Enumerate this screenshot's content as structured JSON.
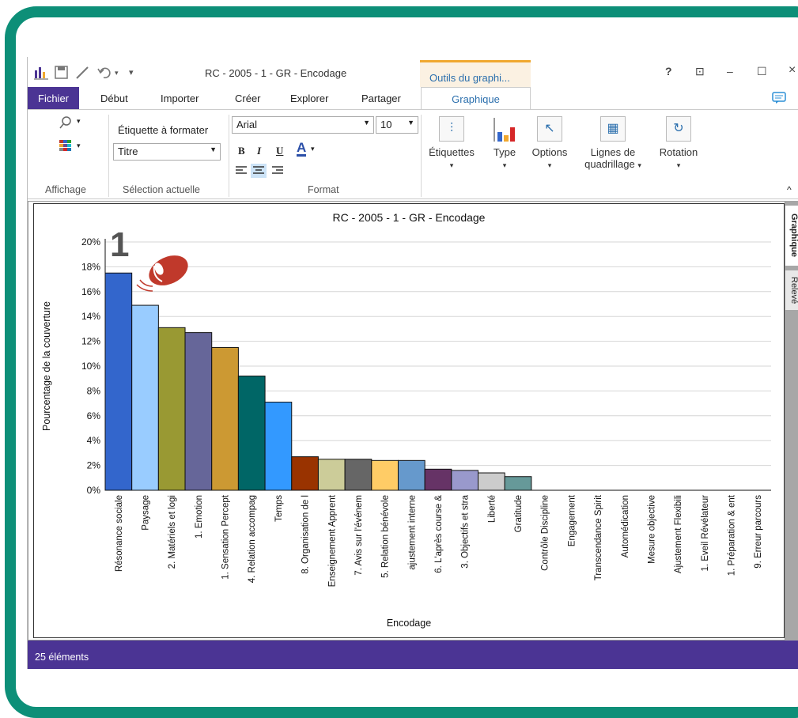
{
  "window": {
    "title": "RC - 2005 - 1 - GR - Encodage",
    "context_tab": "Outils du graphi...",
    "help": "?",
    "restore": "⊡",
    "minimize": "–",
    "maximize": "☐",
    "close": "×"
  },
  "tabs": [
    "Fichier",
    "Début",
    "Importer",
    "Créer",
    "Explorer",
    "Partager",
    "Graphique"
  ],
  "ribbon": {
    "affichage_label": "Affichage",
    "selection_label": "Sélection actuelle",
    "format_label": "Format",
    "etiquette_a_formater": "Étiquette à formater",
    "titre_select": "Titre",
    "font_name": "Arial",
    "font_size": "10",
    "bold": "B",
    "italic": "I",
    "underline": "U",
    "font_color": "A",
    "buttons": {
      "etiquettes": "Étiquettes",
      "type": "Type",
      "options": "Options",
      "lignes_1": "Lignes de",
      "lignes_2": "quadrillage",
      "rotation": "Rotation"
    },
    "collapse": "^"
  },
  "side_tabs": [
    "Graphique",
    "Relevé"
  ],
  "annotation_number": "1",
  "status_text": "25 éléments",
  "colors": {
    "frame": "#0d8f78",
    "purple": "#4b3494",
    "mouse_red": "#c0392b"
  },
  "chart_data": {
    "type": "bar",
    "title": "RC - 2005 - 1 - GR - Encodage",
    "xlabel": "Encodage",
    "ylabel": "Pourcentage de la couverture",
    "ylim": [
      0,
      20
    ],
    "yticks": [
      "0%",
      "2%",
      "4%",
      "6%",
      "8%",
      "10%",
      "12%",
      "14%",
      "16%",
      "18%",
      "20%"
    ],
    "grid": true,
    "categories": [
      "Résonance sociale",
      "Paysage",
      "2. Matériels et logi",
      "1. Emotion",
      "1. Sensation Percept",
      "4. Relation accompag",
      "Temps",
      "8. Organisation de l",
      "Enseignement Apprent",
      "7. Avis sur l'événem",
      "5. Relation bénévole",
      "ajustement interne",
      "6. L'après course &",
      "3. Objectifs et stra",
      "Liberté",
      "Gratitude",
      "Contrôle Discipline",
      "Engagement",
      "Transcendance Spirit",
      "Automédication",
      "Mesure objective",
      "Ajustement Flexibili",
      "1. Eveil Révélateur",
      "1. Préparation & ent",
      "9. Erreur parcours"
    ],
    "values": [
      17.5,
      14.9,
      13.1,
      12.7,
      11.5,
      9.2,
      7.1,
      2.7,
      2.5,
      2.5,
      2.4,
      2.4,
      1.7,
      1.6,
      1.4,
      1.1,
      0,
      0,
      0,
      0,
      0,
      0,
      0,
      0,
      0
    ],
    "bar_colors": [
      "#3366cc",
      "#99ccff",
      "#999933",
      "#666699",
      "#cc9933",
      "#006666",
      "#3399ff",
      "#993300",
      "#cccc99",
      "#666666",
      "#ffcc66",
      "#6699cc",
      "#663366",
      "#9999cc",
      "#cccccc",
      "#669999",
      "#cccc66",
      "#cc6600",
      "#9999ff",
      "#006600",
      "#cc3300",
      "#333399",
      "#999999",
      "#99cc00",
      "#ff9900"
    ]
  }
}
